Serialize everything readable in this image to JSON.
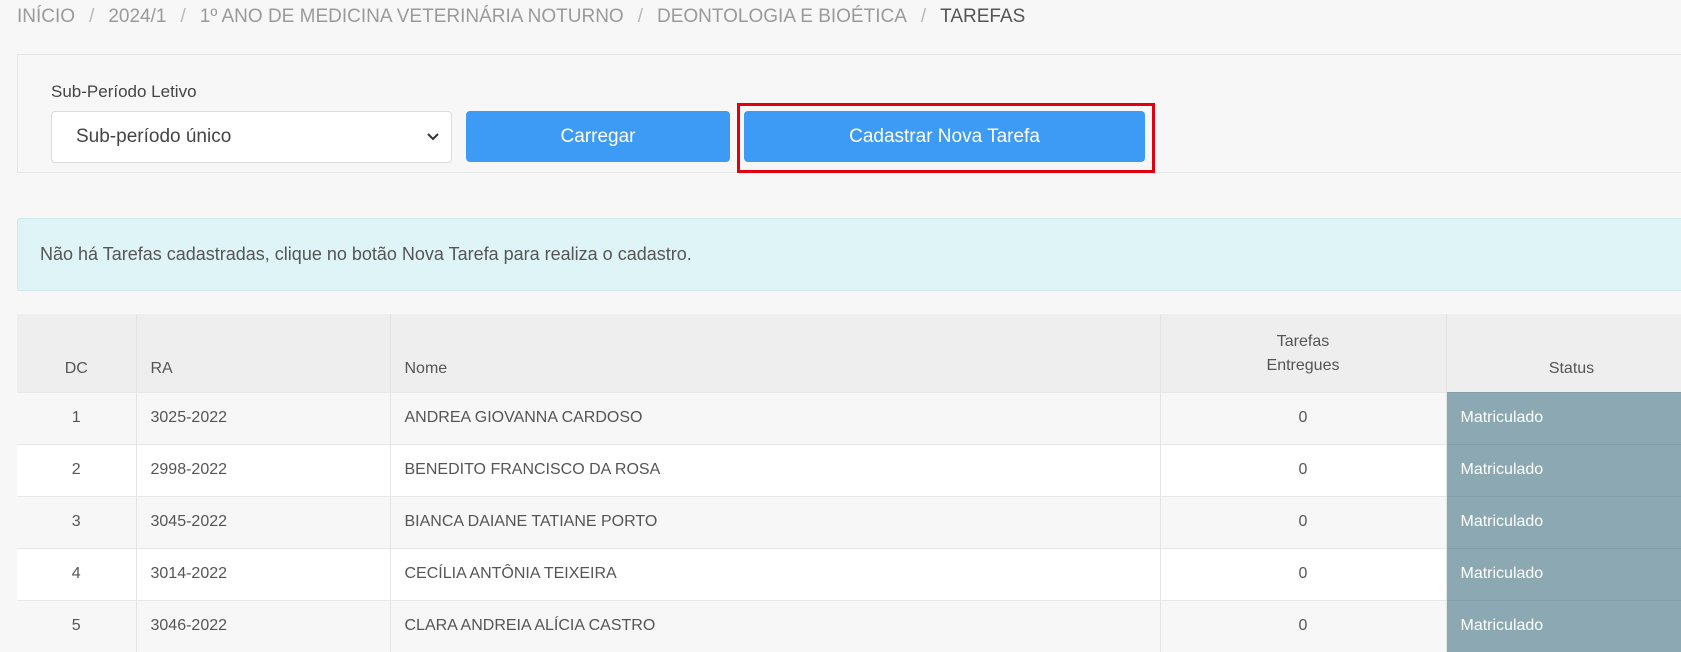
{
  "breadcrumb": {
    "items": [
      "INÍCIO",
      "2024/1",
      "1º ANO DE MEDICINA VETERINÁRIA NOTURNO",
      "DEONTOLOGIA E BIOÉTICA"
    ],
    "current": "TAREFAS",
    "separator": "/"
  },
  "filter": {
    "label": "Sub-Período Letivo",
    "selected": "Sub-período único",
    "load_button": "Carregar",
    "new_button": "Cadastrar Nova Tarefa"
  },
  "alert": {
    "message": "Não há Tarefas cadastradas, clique no botão Nova Tarefa para realiza o cadastro."
  },
  "table": {
    "headers": {
      "dc": "DC",
      "ra": "RA",
      "nome": "Nome",
      "tarefas_line1": "Tarefas",
      "tarefas_line2": "Entregues",
      "status": "Status"
    },
    "rows": [
      {
        "dc": "1",
        "ra": "3025-2022",
        "nome": "ANDREA GIOVANNA CARDOSO",
        "tarefas": "0",
        "status": "Matriculado"
      },
      {
        "dc": "2",
        "ra": "2998-2022",
        "nome": "BENEDITO FRANCISCO DA ROSA",
        "tarefas": "0",
        "status": "Matriculado"
      },
      {
        "dc": "3",
        "ra": "3045-2022",
        "nome": "BIANCA DAIANE TATIANE PORTO",
        "tarefas": "0",
        "status": "Matriculado"
      },
      {
        "dc": "4",
        "ra": "3014-2022",
        "nome": "CECÍLIA ANTÔNIA TEIXEIRA",
        "tarefas": "0",
        "status": "Matriculado"
      },
      {
        "dc": "5",
        "ra": "3046-2022",
        "nome": "CLARA ANDREIA ALÍCIA CASTRO",
        "tarefas": "0",
        "status": "Matriculado"
      }
    ]
  },
  "colors": {
    "primary_button": "#3d9bf6",
    "highlight_border": "#e3000f",
    "alert_bg": "#dff4f7",
    "status_bg": "#8ba8b3"
  },
  "icons": {
    "select_arrow": "chevron-down-icon"
  }
}
